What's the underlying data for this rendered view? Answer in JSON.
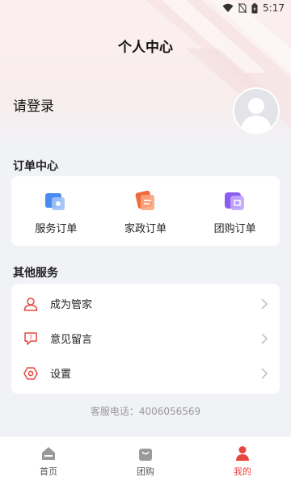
{
  "status_bar": {
    "time": "5:17"
  },
  "header": {
    "title": "个人中心",
    "login_prompt": "请登录"
  },
  "orders": {
    "section_title": "订单中心",
    "items": [
      {
        "label": "服务订单",
        "icon": "service-order-icon",
        "color": "#4a8bf0"
      },
      {
        "label": "家政订单",
        "icon": "housekeeping-order-icon",
        "color": "#f06a3c"
      },
      {
        "label": "团购订单",
        "icon": "group-order-icon",
        "color": "#8a5cf0"
      }
    ]
  },
  "services": {
    "section_title": "其他服务",
    "items": [
      {
        "label": "成为管家",
        "icon": "user-icon"
      },
      {
        "label": "意见留言",
        "icon": "feedback-icon"
      },
      {
        "label": "设置",
        "icon": "settings-icon"
      }
    ]
  },
  "contact": {
    "text": "客服电话：4006056569"
  },
  "tabbar": {
    "items": [
      {
        "label": "首页",
        "icon": "home-icon"
      },
      {
        "label": "团购",
        "icon": "shopping-bag-icon"
      },
      {
        "label": "我的",
        "icon": "profile-icon",
        "active": true
      }
    ]
  },
  "colors": {
    "accent": "#e8473e",
    "background": "#f1f2f6",
    "header": "#fbeeee"
  }
}
